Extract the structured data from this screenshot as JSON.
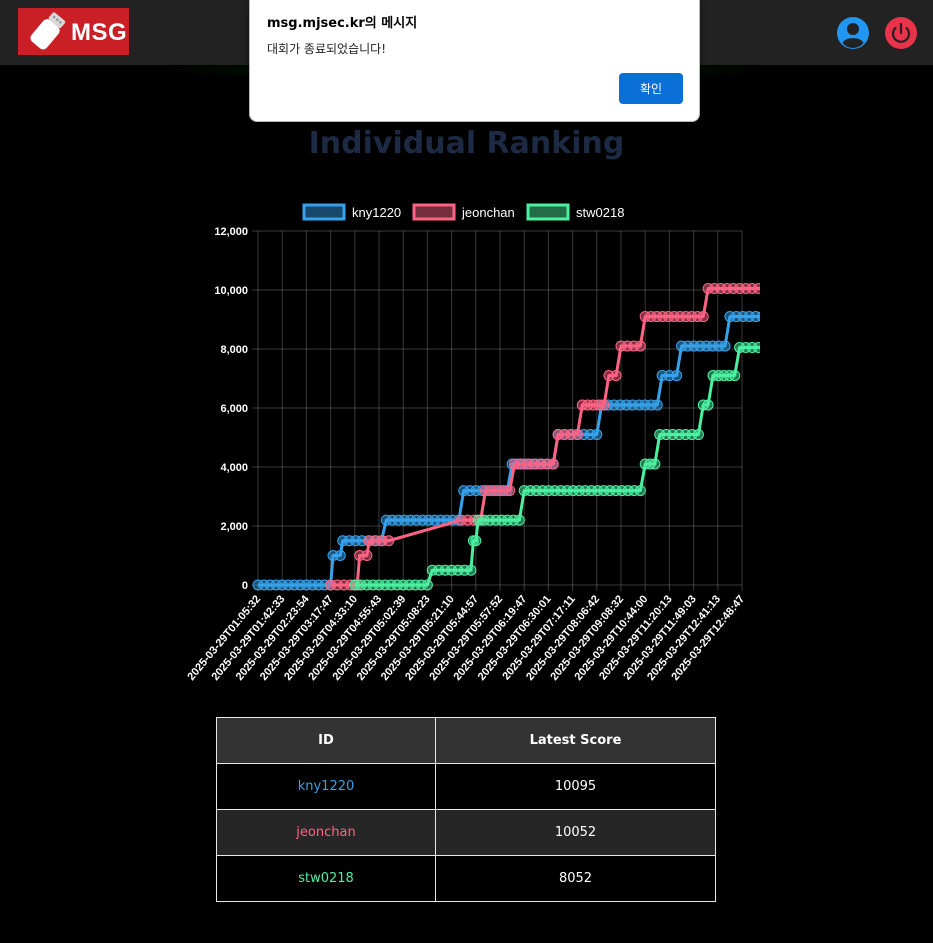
{
  "header": {
    "logo_text": "MSG",
    "colors": {
      "bar": "#222222",
      "logo_bg": "#c91f25",
      "user_icon": "#2196f3",
      "power_icon": "#e8334a"
    },
    "icons": [
      "user-icon",
      "power-icon"
    ]
  },
  "dialog": {
    "title": "msg.mjsec.kr의 메시지",
    "message": "대회가 종료되었습니다!",
    "ok_label": "확인"
  },
  "page": {
    "title": "Individual Ranking"
  },
  "chart_data": {
    "type": "line",
    "stepped": true,
    "ylim": [
      0,
      12000
    ],
    "y_ticks": [
      "12,000",
      "10,000",
      "8,000",
      "6,000",
      "4,000",
      "2,000",
      "0"
    ],
    "x_tick_labels": [
      "2025-03-29T01:05:32",
      "2025-03-29T01:42:33",
      "2025-03-29T02:23:54",
      "2025-03-29T03:17:47",
      "2025-03-29T04:33:10",
      "2025-03-29T04:55:43",
      "2025-03-29T05:02:39",
      "2025-03-29T05:08:23",
      "2025-03-29T05:21:10",
      "2025-03-29T05:44:57",
      "2025-03-29T05:57:52",
      "2025-03-29T06:19:47",
      "2025-03-29T06:30:01",
      "2025-03-29T07:17:11",
      "2025-03-29T08:06:42",
      "2025-03-29T09:08:32",
      "2025-03-29T10:44:00",
      "2025-03-29T11:20:13",
      "2025-03-29T11:49:03",
      "2025-03-29T12:41:13",
      "2025-03-29T12:48:47"
    ],
    "grid": true,
    "legend_position": "top",
    "series": [
      {
        "name": "kny1220",
        "color": "#36a2eb",
        "steps": [
          [
            0,
            0
          ],
          [
            3,
            0
          ],
          [
            3.1,
            1000
          ],
          [
            3.4,
            1000
          ],
          [
            3.5,
            1500
          ],
          [
            5.1,
            1500
          ],
          [
            5.3,
            2200
          ],
          [
            8.3,
            2200
          ],
          [
            8.5,
            3200
          ],
          [
            10.3,
            3200
          ],
          [
            10.5,
            4100
          ],
          [
            12.2,
            4100
          ],
          [
            12.4,
            5100
          ],
          [
            14,
            5100
          ],
          [
            14.2,
            6100
          ],
          [
            16.5,
            6100
          ],
          [
            16.7,
            7100
          ],
          [
            17.3,
            7100
          ],
          [
            17.5,
            8100
          ],
          [
            19.3,
            8100
          ],
          [
            19.5,
            9100
          ],
          [
            21.1,
            9100
          ],
          [
            21.2,
            10095
          ]
        ]
      },
      {
        "name": "jeonchan",
        "color": "#ff6384",
        "steps": [
          [
            3,
            0
          ],
          [
            4.1,
            0
          ],
          [
            4.2,
            1000
          ],
          [
            4.5,
            1000
          ],
          [
            4.6,
            1500
          ],
          [
            5.4,
            1500
          ],
          [
            8.4,
            2200
          ],
          [
            9.2,
            2200
          ],
          [
            9.4,
            3200
          ],
          [
            10.4,
            3200
          ],
          [
            10.6,
            4100
          ],
          [
            12.2,
            4100
          ],
          [
            12.4,
            5100
          ],
          [
            13.2,
            5100
          ],
          [
            13.4,
            6100
          ],
          [
            14.3,
            6100
          ],
          [
            14.5,
            7100
          ],
          [
            14.8,
            7100
          ],
          [
            15,
            8100
          ],
          [
            15.8,
            8100
          ],
          [
            16,
            9100
          ],
          [
            18.4,
            9100
          ],
          [
            18.6,
            10052
          ],
          [
            21.2,
            10052
          ]
        ]
      },
      {
        "name": "stw0218",
        "color": "#4bf0a0",
        "steps": [
          [
            4,
            0
          ],
          [
            7,
            0
          ],
          [
            7.2,
            500
          ],
          [
            8.8,
            500
          ],
          [
            8.9,
            1500
          ],
          [
            9,
            1500
          ],
          [
            9.1,
            2200
          ],
          [
            10.8,
            2200
          ],
          [
            11,
            3200
          ],
          [
            15.8,
            3200
          ],
          [
            16,
            4100
          ],
          [
            16.4,
            4100
          ],
          [
            16.6,
            5100
          ],
          [
            18.2,
            5100
          ],
          [
            18.4,
            6100
          ],
          [
            18.6,
            6100
          ],
          [
            18.8,
            7100
          ],
          [
            19.7,
            7100
          ],
          [
            19.9,
            8052
          ],
          [
            21.2,
            8052
          ]
        ]
      }
    ]
  },
  "table": {
    "headers": [
      "ID",
      "Latest Score"
    ],
    "rows": [
      {
        "id": "kny1220",
        "score": "10095",
        "color": "#36a2eb"
      },
      {
        "id": "jeonchan",
        "score": "10052",
        "color": "#ff6384"
      },
      {
        "id": "stw0218",
        "score": "8052",
        "color": "#4bf0a0"
      }
    ]
  }
}
